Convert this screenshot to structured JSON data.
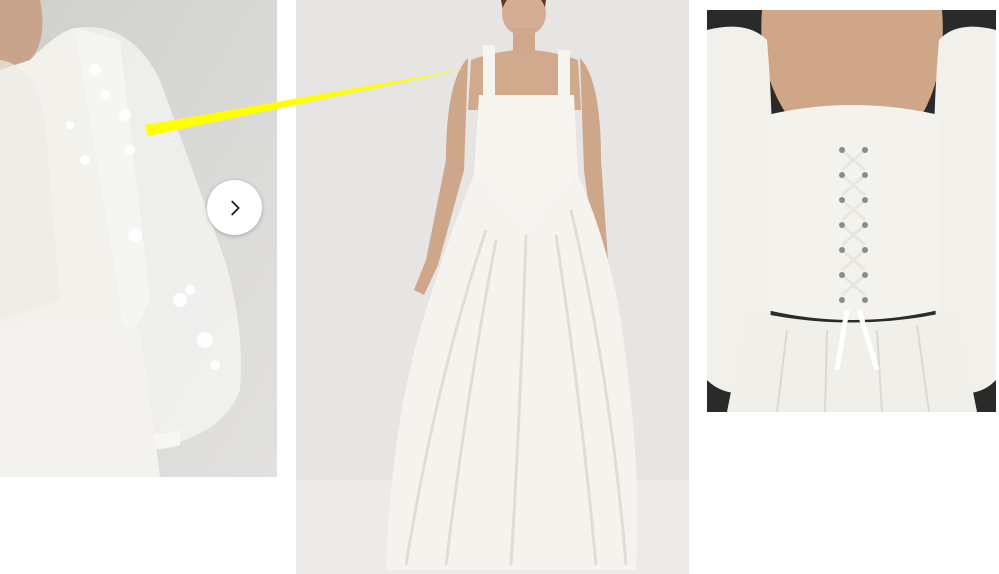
{
  "carousel": {
    "next_button_icon": "chevron-right-icon",
    "images": [
      {
        "name": "sleeve-lace-detail",
        "kind": "photo"
      },
      {
        "name": "dress-front-full",
        "kind": "photo"
      },
      {
        "name": "back-lace-up-detail",
        "kind": "photo"
      }
    ]
  },
  "annotation": {
    "pointer_color": "#ffff00"
  },
  "colors": {
    "background": "#ffffff",
    "dress_white": "#f4f2ee",
    "studio_gray": "#e4e3e2"
  }
}
